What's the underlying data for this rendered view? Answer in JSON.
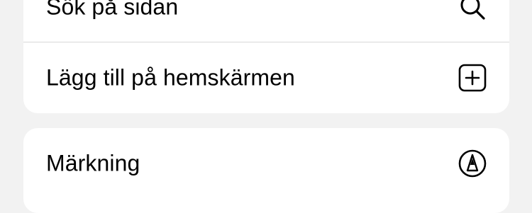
{
  "menu": {
    "group1": {
      "items": [
        {
          "label": "Sök på sidan",
          "icon": "search-icon"
        },
        {
          "label": "Lägg till på hemskärmen",
          "icon": "add-square-icon"
        }
      ]
    },
    "group2": {
      "items": [
        {
          "label": "Märkning",
          "icon": "markup-pen-icon"
        }
      ]
    }
  },
  "colors": {
    "background": "#f2f2f2",
    "card": "#ffffff",
    "divider": "#d8d8d8",
    "text": "#000000"
  }
}
